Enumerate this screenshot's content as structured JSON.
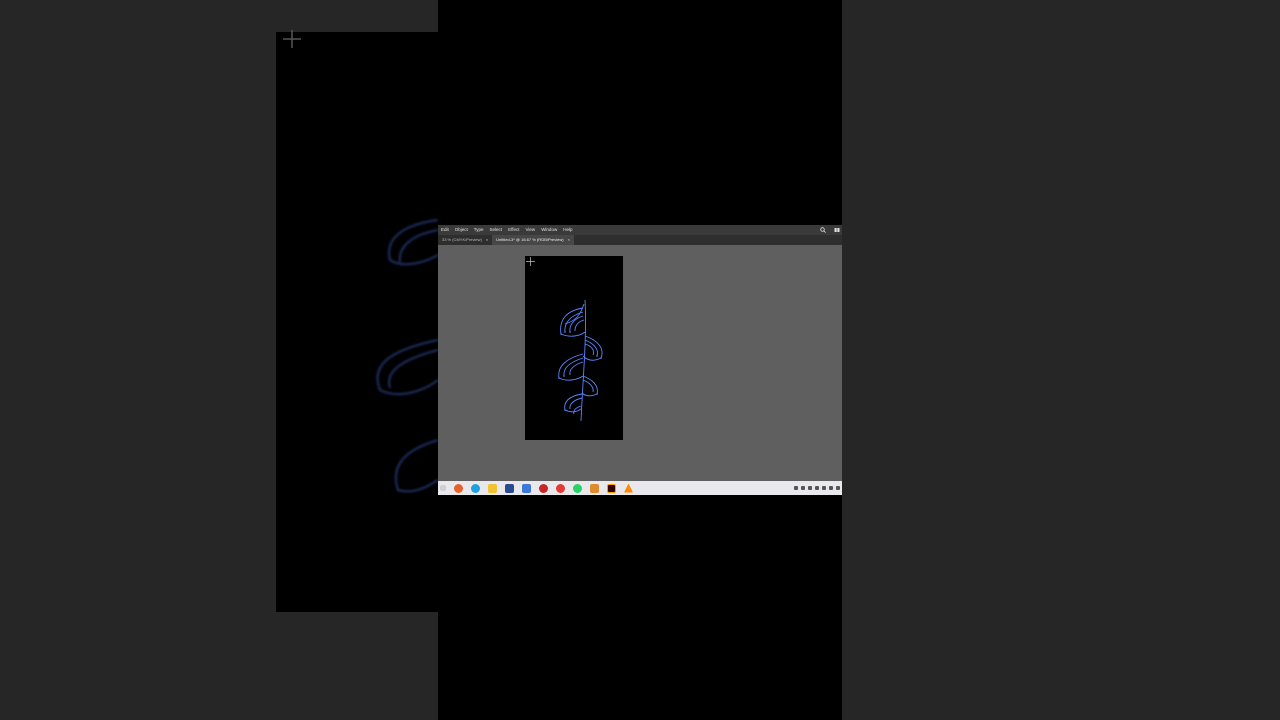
{
  "app": {
    "menus": [
      "Edit",
      "Object",
      "Type",
      "Select",
      "Effect",
      "View",
      "Window",
      "Help"
    ],
    "tabs": [
      {
        "label": "33 % (CMYK/Preview)",
        "active": false
      },
      {
        "label": "Untitled-3* @ 16.67 % (RGB/Preview)",
        "active": true
      }
    ],
    "tab_close": "×"
  },
  "icons": {
    "menubar": [
      "search-icon",
      "arrange-documents-icon"
    ],
    "taskbar": [
      "search-icon",
      "firefox-icon",
      "edge-icon",
      "file-explorer-icon",
      "store-icon",
      "settings-icon",
      "app-icon",
      "chrome-icon",
      "whatsapp-icon",
      "app-icon",
      "illustrator-icon",
      "vlc-icon"
    ]
  },
  "colors": {
    "art_stroke": "#5b86ff",
    "canvas": "#5f5f5f",
    "artboard": "#000000"
  }
}
